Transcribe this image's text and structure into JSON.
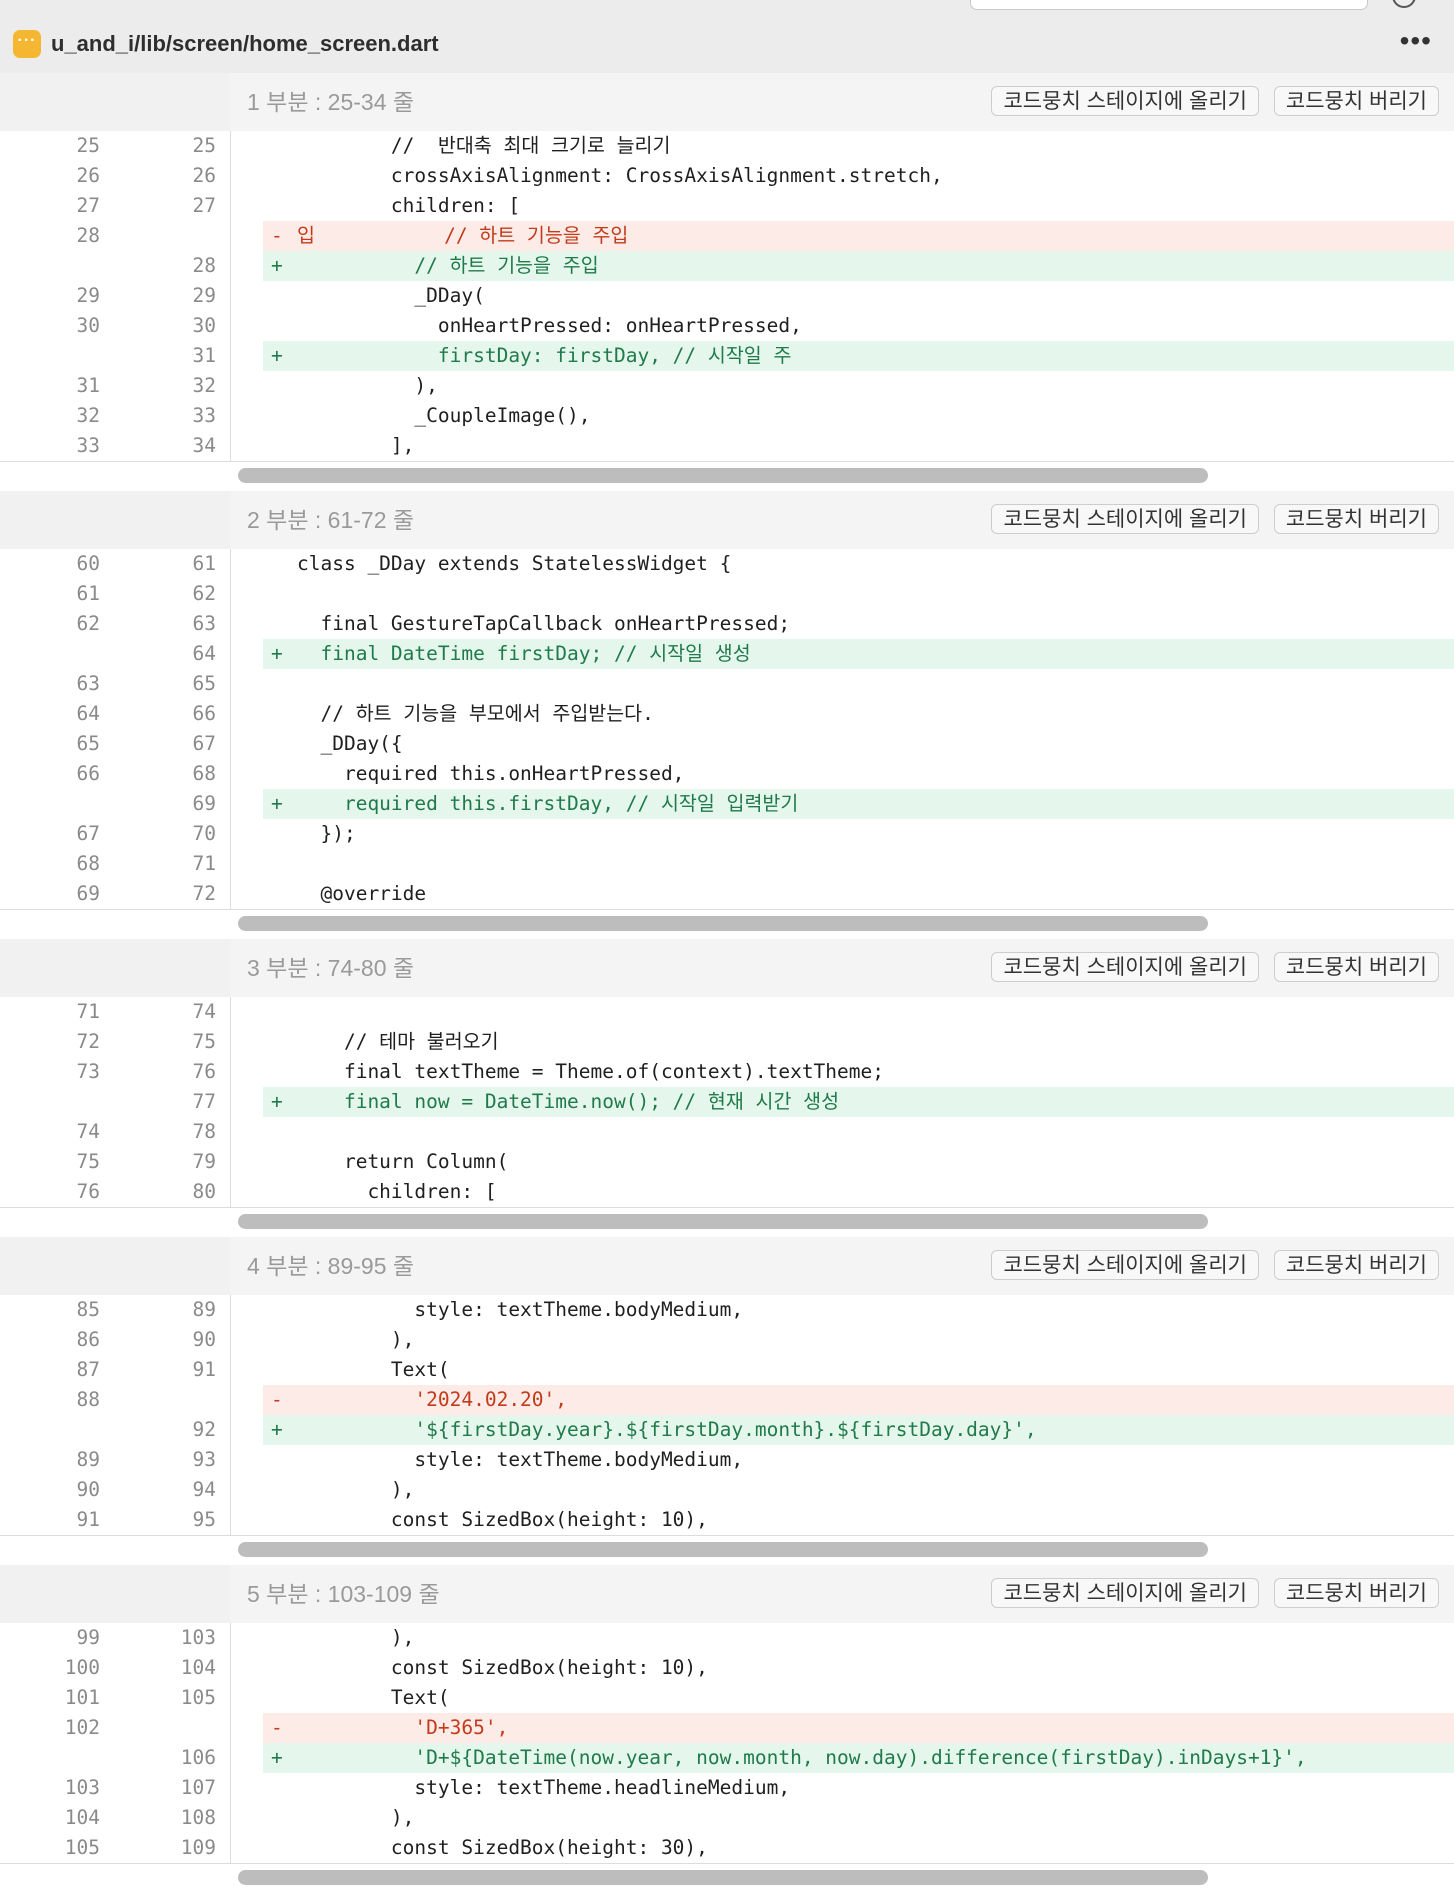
{
  "file": {
    "icon": "more-dots-icon",
    "icon_glyph": "···",
    "path": "u_and_i/lib/screen/home_screen.dart",
    "more_glyph": "•••"
  },
  "colors": {
    "added_bg": "#e5f7ed",
    "added_text": "#207a4a",
    "removed_bg": "#fdebe8",
    "removed_text": "#c23b1a",
    "file_icon": "#f5b731"
  },
  "hunks": [
    {
      "title": "1 부분 : 25-34 줄",
      "stage_label": "코드뭉치 스테이지에 올리기",
      "discard_label": "코드뭉치 버리기",
      "lines": [
        {
          "type": "ctx",
          "old": "25",
          "new": "25",
          "sign": "",
          "code": "        //  반대축 최대 크기로 늘리기"
        },
        {
          "type": "ctx",
          "old": "26",
          "new": "26",
          "sign": "",
          "code": "        crossAxisAlignment: CrossAxisAlignment.stretch,"
        },
        {
          "type": "ctx",
          "old": "27",
          "new": "27",
          "sign": "",
          "code": "        children: ["
        },
        {
          "type": "del",
          "old": "28",
          "new": "",
          "sign": "-",
          "code": "입           // 하트 기능을 주입"
        },
        {
          "type": "add",
          "old": "",
          "new": "28",
          "sign": "+",
          "code": "          // 하트 기능을 주입"
        },
        {
          "type": "ctx",
          "old": "29",
          "new": "29",
          "sign": "",
          "code": "          _DDay("
        },
        {
          "type": "ctx",
          "old": "30",
          "new": "30",
          "sign": "",
          "code": "            onHeartPressed: onHeartPressed,"
        },
        {
          "type": "add",
          "old": "",
          "new": "31",
          "sign": "+",
          "code": "            firstDay: firstDay, // 시작일 주"
        },
        {
          "type": "ctx",
          "old": "31",
          "new": "32",
          "sign": "",
          "code": "          ),"
        },
        {
          "type": "ctx",
          "old": "32",
          "new": "33",
          "sign": "",
          "code": "          _CoupleImage(),"
        },
        {
          "type": "ctx",
          "old": "33",
          "new": "34",
          "sign": "",
          "code": "        ],"
        }
      ]
    },
    {
      "title": "2 부분 : 61-72 줄",
      "stage_label": "코드뭉치 스테이지에 올리기",
      "discard_label": "코드뭉치 버리기",
      "lines": [
        {
          "type": "ctx",
          "old": "60",
          "new": "61",
          "sign": "",
          "code": "class _DDay extends StatelessWidget {"
        },
        {
          "type": "ctx",
          "old": "61",
          "new": "62",
          "sign": "",
          "code": ""
        },
        {
          "type": "ctx",
          "old": "62",
          "new": "63",
          "sign": "",
          "code": "  final GestureTapCallback onHeartPressed;"
        },
        {
          "type": "add",
          "old": "",
          "new": "64",
          "sign": "+",
          "code": "  final DateTime firstDay; // 시작일 생성"
        },
        {
          "type": "ctx",
          "old": "63",
          "new": "65",
          "sign": "",
          "code": ""
        },
        {
          "type": "ctx",
          "old": "64",
          "new": "66",
          "sign": "",
          "code": "  // 하트 기능을 부모에서 주입받는다."
        },
        {
          "type": "ctx",
          "old": "65",
          "new": "67",
          "sign": "",
          "code": "  _DDay({"
        },
        {
          "type": "ctx",
          "old": "66",
          "new": "68",
          "sign": "",
          "code": "    required this.onHeartPressed,"
        },
        {
          "type": "add",
          "old": "",
          "new": "69",
          "sign": "+",
          "code": "    required this.firstDay, // 시작일 입력받기"
        },
        {
          "type": "ctx",
          "old": "67",
          "new": "70",
          "sign": "",
          "code": "  });"
        },
        {
          "type": "ctx",
          "old": "68",
          "new": "71",
          "sign": "",
          "code": ""
        },
        {
          "type": "ctx",
          "old": "69",
          "new": "72",
          "sign": "",
          "code": "  @override"
        }
      ]
    },
    {
      "title": "3 부분 : 74-80 줄",
      "stage_label": "코드뭉치 스테이지에 올리기",
      "discard_label": "코드뭉치 버리기",
      "lines": [
        {
          "type": "ctx",
          "old": "71",
          "new": "74",
          "sign": "",
          "code": ""
        },
        {
          "type": "ctx",
          "old": "72",
          "new": "75",
          "sign": "",
          "code": "    // 테마 불러오기"
        },
        {
          "type": "ctx",
          "old": "73",
          "new": "76",
          "sign": "",
          "code": "    final textTheme = Theme.of(context).textTheme;"
        },
        {
          "type": "add",
          "old": "",
          "new": "77",
          "sign": "+",
          "code": "    final now = DateTime.now(); // 현재 시간 생성"
        },
        {
          "type": "ctx",
          "old": "74",
          "new": "78",
          "sign": "",
          "code": ""
        },
        {
          "type": "ctx",
          "old": "75",
          "new": "79",
          "sign": "",
          "code": "    return Column("
        },
        {
          "type": "ctx",
          "old": "76",
          "new": "80",
          "sign": "",
          "code": "      children: ["
        }
      ]
    },
    {
      "title": "4 부분 : 89-95 줄",
      "stage_label": "코드뭉치 스테이지에 올리기",
      "discard_label": "코드뭉치 버리기",
      "lines": [
        {
          "type": "ctx",
          "old": "85",
          "new": "89",
          "sign": "",
          "code": "          style: textTheme.bodyMedium,"
        },
        {
          "type": "ctx",
          "old": "86",
          "new": "90",
          "sign": "",
          "code": "        ),"
        },
        {
          "type": "ctx",
          "old": "87",
          "new": "91",
          "sign": "",
          "code": "        Text("
        },
        {
          "type": "del",
          "old": "88",
          "new": "",
          "sign": "-",
          "code": "          '2024.02.20',"
        },
        {
          "type": "add",
          "old": "",
          "new": "92",
          "sign": "+",
          "code": "          '${firstDay.year}.${firstDay.month}.${firstDay.day}',"
        },
        {
          "type": "ctx",
          "old": "89",
          "new": "93",
          "sign": "",
          "code": "          style: textTheme.bodyMedium,"
        },
        {
          "type": "ctx",
          "old": "90",
          "new": "94",
          "sign": "",
          "code": "        ),"
        },
        {
          "type": "ctx",
          "old": "91",
          "new": "95",
          "sign": "",
          "code": "        const SizedBox(height: 10),"
        }
      ]
    },
    {
      "title": "5 부분 : 103-109 줄",
      "stage_label": "코드뭉치 스테이지에 올리기",
      "discard_label": "코드뭉치 버리기",
      "lines": [
        {
          "type": "ctx",
          "old": "99",
          "new": "103",
          "sign": "",
          "code": "        ),"
        },
        {
          "type": "ctx",
          "old": "100",
          "new": "104",
          "sign": "",
          "code": "        const SizedBox(height: 10),"
        },
        {
          "type": "ctx",
          "old": "101",
          "new": "105",
          "sign": "",
          "code": "        Text("
        },
        {
          "type": "del",
          "old": "102",
          "new": "",
          "sign": "-",
          "code": "          'D+365',"
        },
        {
          "type": "add",
          "old": "",
          "new": "106",
          "sign": "+",
          "code": "          'D+${DateTime(now.year, now.month, now.day).difference(firstDay).inDays+1}',"
        },
        {
          "type": "ctx",
          "old": "103",
          "new": "107",
          "sign": "",
          "code": "          style: textTheme.headlineMedium,"
        },
        {
          "type": "ctx",
          "old": "104",
          "new": "108",
          "sign": "",
          "code": "        ),"
        },
        {
          "type": "ctx",
          "old": "105",
          "new": "109",
          "sign": "",
          "code": "        const SizedBox(height: 30),"
        }
      ]
    }
  ]
}
